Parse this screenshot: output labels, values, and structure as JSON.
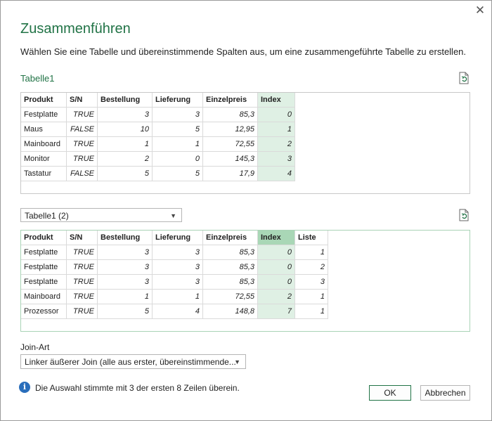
{
  "dialog": {
    "title": "Zusammenführen",
    "subtitle": "Wählen Sie eine Tabelle und übereinstimmende Spalten aus, um eine zusammengeführte Tabelle zu erstellen.",
    "close_glyph": "✕"
  },
  "table1": {
    "label": "Tabelle1",
    "columns": [
      "Produkt",
      "S/N",
      "Bestellung",
      "Lieferung",
      "Einzelpreis",
      "Index"
    ],
    "rows": [
      [
        "Festplatte",
        "TRUE",
        "3",
        "3",
        "85,3",
        "0"
      ],
      [
        "Maus",
        "FALSE",
        "10",
        "5",
        "12,95",
        "1"
      ],
      [
        "Mainboard",
        "TRUE",
        "1",
        "1",
        "72,55",
        "2"
      ],
      [
        "Monitor",
        "TRUE",
        "2",
        "0",
        "145,3",
        "3"
      ],
      [
        "Tastatur",
        "FALSE",
        "5",
        "5",
        "17,9",
        "4"
      ]
    ]
  },
  "table2": {
    "selected": "Tabelle1 (2)",
    "columns": [
      "Produkt",
      "S/N",
      "Bestellung",
      "Lieferung",
      "Einzelpreis",
      "Index",
      "Liste"
    ],
    "rows": [
      [
        "Festplatte",
        "TRUE",
        "3",
        "3",
        "85,3",
        "0",
        "1"
      ],
      [
        "Festplatte",
        "TRUE",
        "3",
        "3",
        "85,3",
        "0",
        "2"
      ],
      [
        "Festplatte",
        "TRUE",
        "3",
        "3",
        "85,3",
        "0",
        "3"
      ],
      [
        "Mainboard",
        "TRUE",
        "1",
        "1",
        "72,55",
        "2",
        "1"
      ],
      [
        "Prozessor",
        "TRUE",
        "5",
        "4",
        "148,8",
        "7",
        "1"
      ]
    ]
  },
  "join": {
    "label": "Join-Art",
    "selected": "Linker äußerer Join (alle aus erster, übereinstimmende..."
  },
  "info": {
    "icon": "info-icon",
    "text": "Die Auswahl stimmte mit 3 der ersten 8 Zeilen überein."
  },
  "buttons": {
    "ok": "OK",
    "cancel": "Abbrechen"
  },
  "icons": {
    "refresh": "refresh-icon",
    "dropdown": "▼"
  },
  "colors": {
    "accent": "#217346",
    "index_selected": "#a9d7b6",
    "index_highlight": "#dff0e4"
  }
}
